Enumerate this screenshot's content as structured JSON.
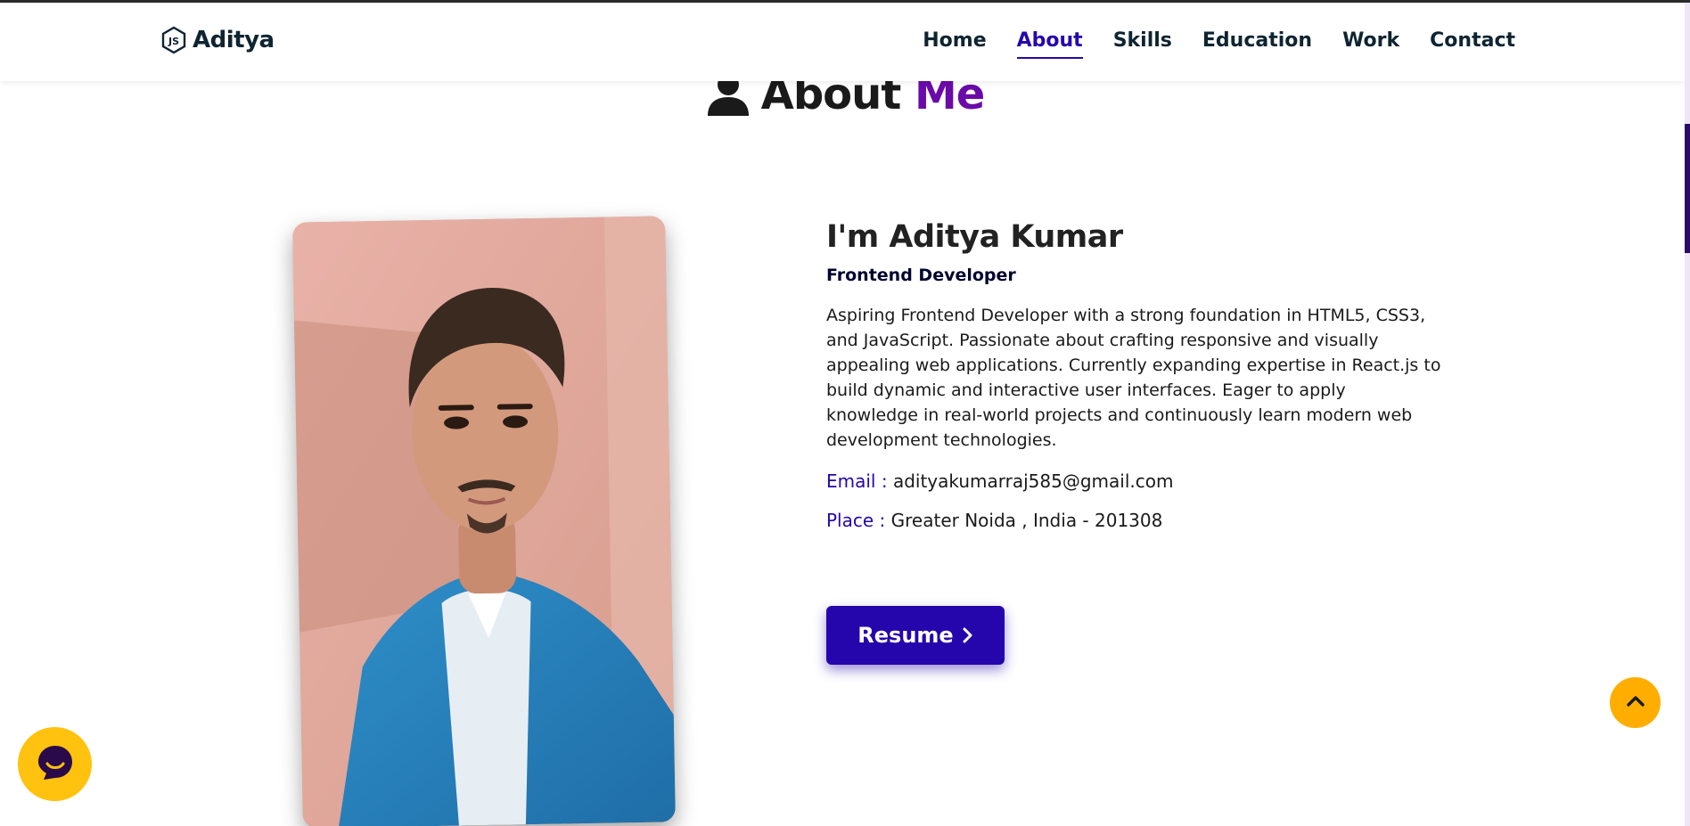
{
  "brand": {
    "name": "Aditya",
    "icon": "js-hex-logo-icon"
  },
  "nav": {
    "items": [
      {
        "label": "Home",
        "active": false
      },
      {
        "label": "About",
        "active": true
      },
      {
        "label": "Skills",
        "active": false
      },
      {
        "label": "Education",
        "active": false
      },
      {
        "label": "Work",
        "active": false
      },
      {
        "label": "Contact",
        "active": false
      }
    ]
  },
  "heading": {
    "icon": "user-icon",
    "text": "About",
    "accent": "Me"
  },
  "profile": {
    "name": "I'm Aditya Kumar",
    "role": "Frontend Developer",
    "bio": "Aspiring Frontend Developer with a strong foundation in HTML5, CSS3, and JavaScript. Passionate about crafting responsive and visually appealing web applications. Currently expanding expertise in React.js to build dynamic and interactive user interfaces. Eager to apply knowledge in real-world projects and continuously learn modern web development technologies.",
    "email_label": "Email :",
    "email": "adityakumarraj585@gmail.com",
    "place_label": "Place :",
    "place": "Greater Noida , India - 201308"
  },
  "resume": {
    "label": "Resume",
    "icon": "chevron-right-icon"
  },
  "widgets": {
    "scroll_top_icon": "chevron-up-icon",
    "chat_icon": "chat-bubble-icon"
  },
  "colors": {
    "accent": "#2506ad",
    "heading_accent": "#6a0aa8",
    "scroll_top": "#ffae00",
    "chat": "#ffc20e",
    "dark": "#0e2431"
  }
}
